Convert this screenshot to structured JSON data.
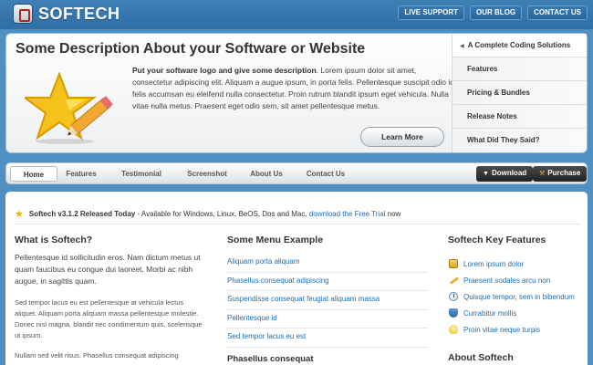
{
  "brand": {
    "name": "SOFTECH"
  },
  "top_nav": [
    "LIVE SUPPORT",
    "OUR BLOG",
    "CONTACT US"
  ],
  "hero": {
    "title": "Some Description About your Software or Website",
    "lead": "Put your software logo and give some description",
    "body": ". Lorem ipsum dolor sit amet, consectetur adipiscing elit. Aliquam a augue ipsum, in porta felis. Pellentesque suscipit odio id felis accumsan eu eleifend nulla consectetur. Proin rutrum blandit ipsum eget vehicula. Nulla vitae nulla metus. Praesent eget odio sem, sit amet pellentesque metus.",
    "button": "Learn More"
  },
  "side_menu": [
    "A Complete Coding Solutions",
    "Features",
    "Pricing & Bundles",
    "Release Notes",
    "What Did They Said?"
  ],
  "main_nav": [
    "Home",
    "Features",
    "Testimonial",
    "Screenshot",
    "About Us",
    "Contact Us"
  ],
  "actions": {
    "download": "Download",
    "purchase": "Purchase"
  },
  "release": {
    "title": "Softech v3.1.2 Released Today",
    "text": " - Available for Windows, Linux, BeOS, Dos and Mac, ",
    "link": "download the Free Trial",
    "suffix": " now"
  },
  "col1": {
    "title": "What is Softech?",
    "p1": "Pellentesque id sollicitudin eros. Nam dictum metus ut quam faucibus eu congue dui laoreet. Morbi ac nibh augue, in sagittis quam.",
    "p2": "Sed tempor lacus eu est pellentesque at vehicula lectus aliquet. Aliquam porta aliquam massa pellentesque molestie. Donec nisl magna, blandit nec condimentum quis, scelerisque ut ipsum.",
    "p3": "Nullam sed velit risus. Phasellus consequat adipiscing"
  },
  "col2": {
    "title": "Some Menu Example",
    "items": [
      "Aliquam porta aliquam",
      "Phasellus consequat adipiscing",
      "Suspendisse consequat feugiat aliquam massa",
      "Pellentesque id",
      "Sed tempor lacus eu est"
    ],
    "subtitle": "Phasellus consequat"
  },
  "col3": {
    "title": "Softech Key Features",
    "items": [
      {
        "label": "Lorem ipsum dolor",
        "icon": "box-icon"
      },
      {
        "label": "Praesent sodales arcu non",
        "icon": "pencil-icon"
      },
      {
        "label": "Quisque tempor, sem in bibendum",
        "icon": "clock-icon"
      },
      {
        "label": "Currabitur mollis",
        "icon": "shield-icon"
      },
      {
        "label": "Proin vitae neque turpis",
        "icon": "bulb-icon"
      }
    ],
    "subtitle": "About Softech"
  },
  "colors": {
    "accent": "#1a6db3",
    "header": "#3a7ab2",
    "background": "#4f8fc2"
  }
}
